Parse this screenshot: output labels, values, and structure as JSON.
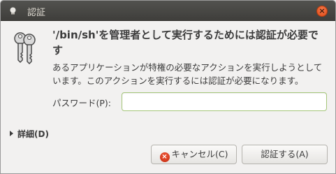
{
  "window": {
    "title": "認証",
    "close_symbol": "×"
  },
  "icons": {
    "app": "app-dot-icon",
    "close": "close-icon",
    "keys": "keys-icon",
    "cancel": "cancel-icon"
  },
  "dialog": {
    "heading": "'/bin/sh'を管理者として実行するためには認証が必要です",
    "message": "あるアプリケーションが特権の必要なアクションを実行しようとしています。このアクションを実行するには認証が必要になります。",
    "password_label": "パスワード(P):",
    "password_value": "",
    "details_label": "詳細(D)"
  },
  "buttons": {
    "cancel_label": "キャンセル(C)",
    "cancel_symbol": "×",
    "authenticate_label": "認証する(A)"
  },
  "colors": {
    "titlebar": "#3f3e3b",
    "close": "#df4a16",
    "input_focus_border": "#a5c67a",
    "background": "#f2f1f0"
  }
}
